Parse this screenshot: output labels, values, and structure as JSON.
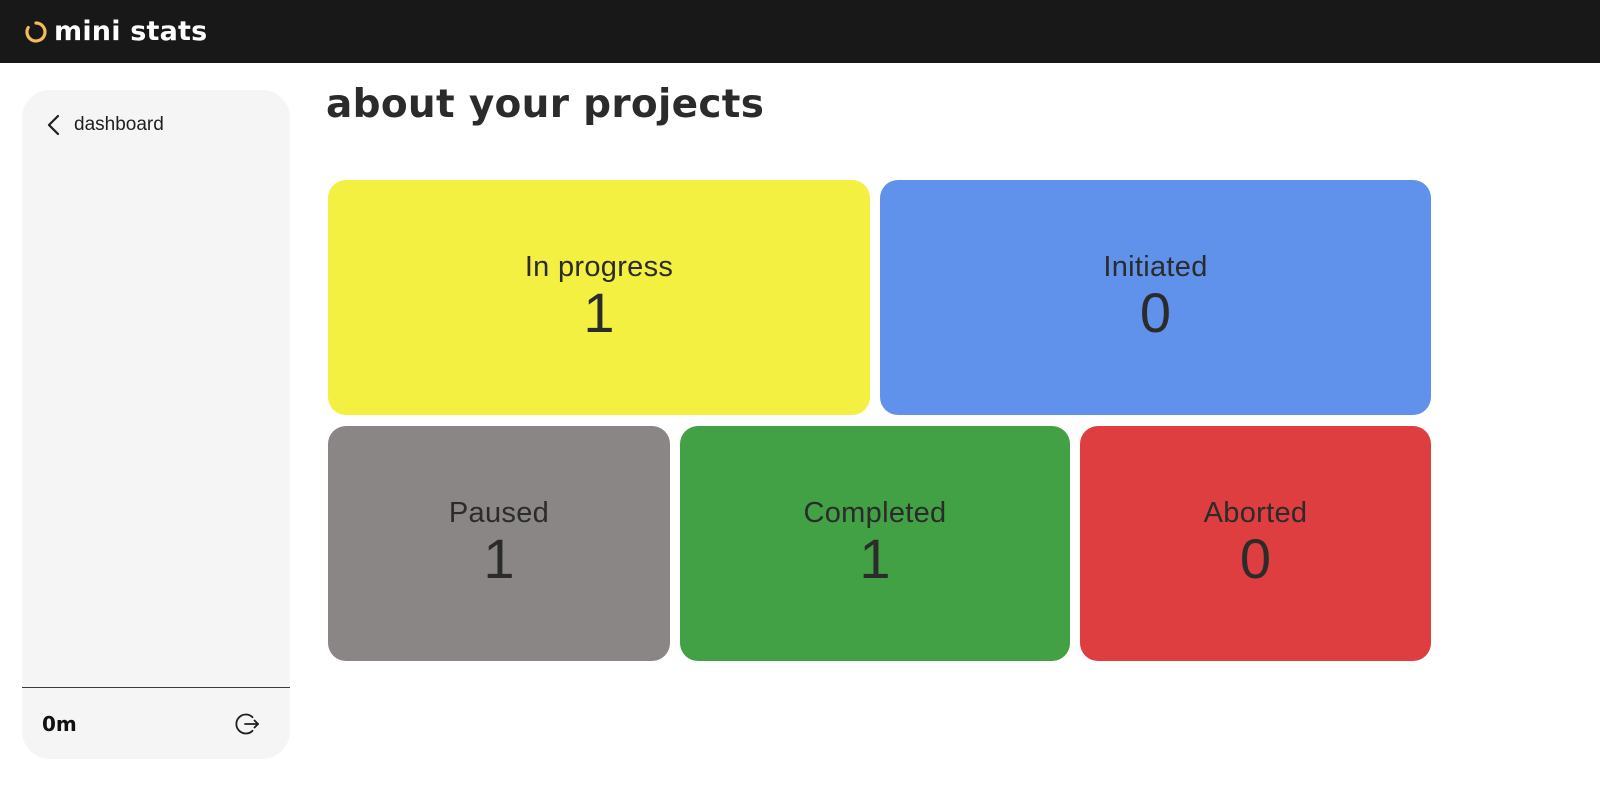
{
  "header": {
    "app_title": "mini stats",
    "logo_icon": "ring-logo-icon",
    "logo_color": "#F2BC57",
    "background": "#181818"
  },
  "sidebar": {
    "back_link": {
      "label": "dashboard",
      "icon": "chevron-left-icon"
    },
    "footer": {
      "timer": "0m",
      "logout_icon": "logout-icon"
    }
  },
  "main": {
    "title": "about your projects",
    "stats": [
      {
        "label": "In progress",
        "count": "1",
        "color": "#F3F041"
      },
      {
        "label": "Initiated",
        "count": "0",
        "color": "#6091EB"
      },
      {
        "label": "Paused",
        "count": "1",
        "color": "#8A8685"
      },
      {
        "label": "Completed",
        "count": "1",
        "color": "#42A045"
      },
      {
        "label": "Aborted",
        "count": "0",
        "color": "#DE3E3F"
      }
    ]
  }
}
